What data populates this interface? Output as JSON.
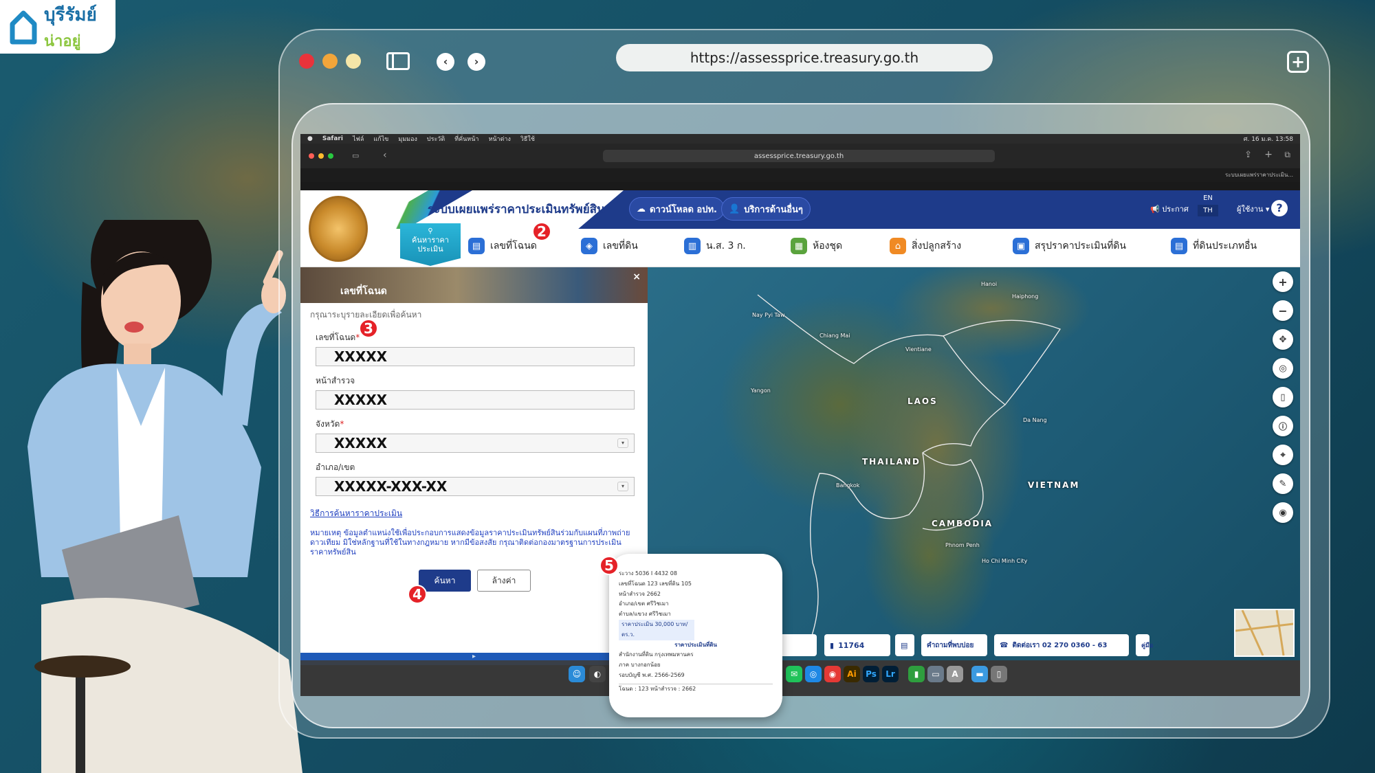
{
  "brand": {
    "line1": "บุรีรัมย์",
    "line2": "น่าอยู่"
  },
  "outer_browser": {
    "url": "https://assessprice.treasury.go.th"
  },
  "mac_menubar": {
    "items": [
      "Safari",
      "ไฟล์",
      "แก้ไข",
      "มุมมอง",
      "ประวัติ",
      "ที่คั่นหน้า",
      "หน้าต่าง",
      "วิธีใช้"
    ],
    "clock": "ศ. 16 ม.ค. 13:58"
  },
  "safari": {
    "address": "assessprice.treasury.go.th",
    "tab": "ระบบเผยแพร่ราคาประเมิน..."
  },
  "site": {
    "title": "ระบบเผยแพร่ราคาประเมินทรัพย์สิน",
    "download_btn": "ดาวน์โหลด อปท.",
    "services_btn": "บริการด้านอื่นๆ",
    "announce": "ประกาศ",
    "lang_en": "EN",
    "lang_th": "TH",
    "user": "ผู้ใช้งาน",
    "help": "?"
  },
  "nav": {
    "active_label": "ค้นหาราคาประเมิน",
    "items": [
      {
        "label": "เลขที่โฉนด",
        "icon": "deed-icon",
        "color": "#2b6fd6"
      },
      {
        "label": "เลขที่ดิน",
        "icon": "layers-icon",
        "color": "#2b6fd6"
      },
      {
        "label": "น.ส. 3 ก.",
        "icon": "map-book-icon",
        "color": "#2b6fd6"
      },
      {
        "label": "ห้องชุด",
        "icon": "building-icon",
        "color": "#5aa33d"
      },
      {
        "label": "สิ่งปลูกสร้าง",
        "icon": "house-icon",
        "color": "#f08a24"
      },
      {
        "label": "สรุปราคาประเมินที่ดิน",
        "icon": "summary-icon",
        "color": "#2b6fd6"
      },
      {
        "label": "ที่ดินประเภทอื่น",
        "icon": "document-icon",
        "color": "#2b6fd6"
      }
    ]
  },
  "form": {
    "title": "เลขที่โฉนด",
    "close": "×",
    "hint": "กรุณาระบุรายละเอียดเพื่อค้นหา",
    "deed_label": "เลขที่โฉนด",
    "deed_value": "XXXXX",
    "survey_label": "หน้าสำรวจ",
    "survey_value": "XXXXX",
    "province_label": "จังหวัด",
    "province_value": "XXXXX",
    "district_label": "อำเภอ/เขต",
    "district_value": "XXXXX-XXX-XX",
    "howto": "วิธีการค้นหาราคาประเมิน",
    "note": "หมายเหตุ ข้อมูลตำแหน่งใช้เพื่อประกอบการแสดงข้อมูลราคาประเมินทรัพย์สินร่วมกับแผนที่ภาพถ่ายดาวเทียม มิใช่หลักฐานที่ใช้ในทางกฎหมาย หากมีข้อสงสัย กรุณาติดต่อกองมาตรฐานการประเมินราคาทรัพย์สิน",
    "search_btn": "ค้นหา",
    "clear_btn": "ล้างค่า",
    "required": "*"
  },
  "map": {
    "labels": [
      "LAOS",
      "THAILAND",
      "VIETNAM",
      "CAMBODIA"
    ],
    "small_labels": [
      "Hanoi",
      "Haiphong",
      "Nay Pyi Taw",
      "Yangon",
      "Chiang Mai",
      "Vientiane",
      "Bangkok",
      "Phnom Penh",
      "Ho Chi Minh City",
      "Da Nang"
    ]
  },
  "statusbar": {
    "count": "11764",
    "faq": "คำถามที่พบบ่อย",
    "contact": "ติดต่อเรา 02 270 0360 - 63",
    "extra": "คู่มือ"
  },
  "badges": [
    "2",
    "3",
    "4",
    "5"
  ],
  "popup": {
    "lines": [
      "ระวาง 5036 I 4432 08",
      "เลขที่โฉนด 123 เลขที่ดิน 105",
      "หน้าสำรวจ 2662",
      "อำเภอ/เขต ศรีวิชเมา",
      "ตำบล/แขวง ศรีวิชเมา",
      "ราคาประเมิน 30,000 บาท/ตร.ว.",
      "ราคาประเมินที่ดิน",
      "สำนักงานที่ดิน กรุงเทพมหานคร",
      "ภาค บางกอกน้อย",
      "รอบบัญชี พ.ศ. 2566-2569",
      "โฉนด : 123 หน้าสำรวจ : 2662"
    ]
  }
}
